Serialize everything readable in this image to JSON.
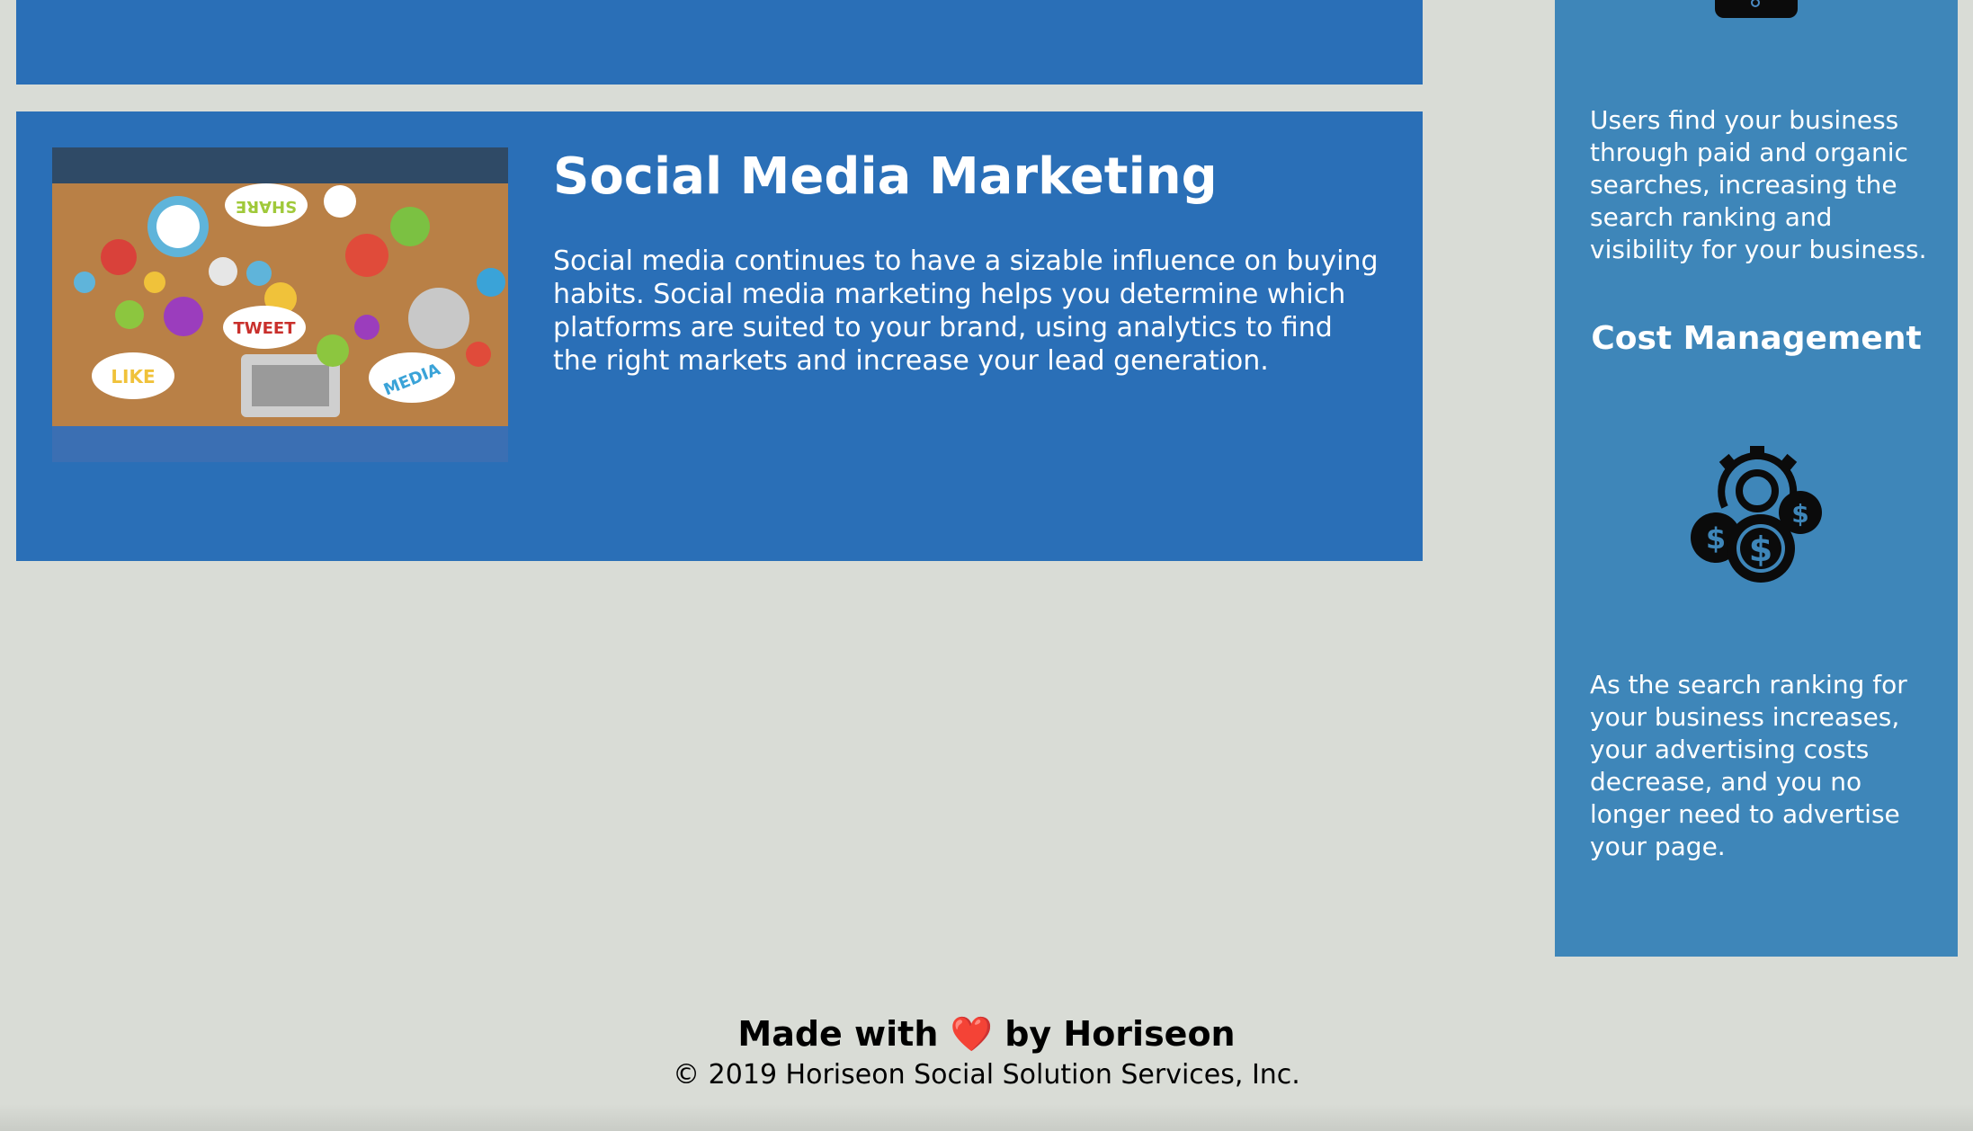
{
  "colors": {
    "page_background": "#d9dcd6",
    "card_background": "#2a6fb7",
    "aside_background": "#3e86b9",
    "heart": "#e02020"
  },
  "social_media_card": {
    "image_icon": "social-media-collage-image",
    "image_words": [
      "SHARE",
      "TWEET",
      "LIKE",
      "MEDIA"
    ],
    "title": "Social Media Marketing",
    "body": "Social media continues to have a sizable influence on buying habits. Social media marketing helps you determine which platforms are suited to your brand, using analytics to find the right markets and increase your lead generation."
  },
  "aside": {
    "top_icon": "dark-rounded-icon",
    "paragraph1": "Users find your business through paid and organic searches, increasing the search ranking and visibility for your business.",
    "cost_heading": "Cost Management",
    "cost_icon": "gear-dollar-coins-icon",
    "paragraph2": "As the search ranking for your business increases, your advertising costs decrease, and you no longer need to advertise your page."
  },
  "footer": {
    "made_with": "Made with",
    "heart_icon": "heart-icon",
    "heart_glyph": "❤️",
    "by": "by Horiseon",
    "copyright": "© 2019 Horiseon Social Solution Services, Inc."
  }
}
